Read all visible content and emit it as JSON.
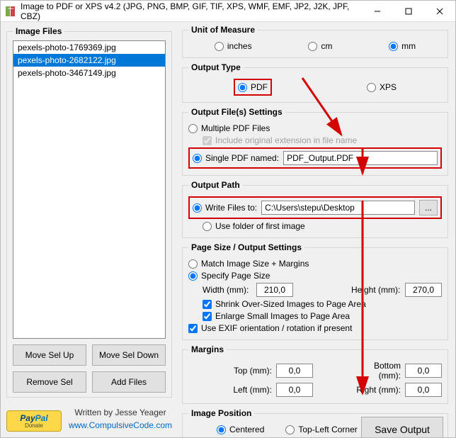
{
  "title": "Image to PDF or XPS  v4.2    (JPG, PNG, BMP, GIF, TIF, XPS, WMF, EMF, JP2, J2K, JPF, CBZ)",
  "left": {
    "legend": "Image Files",
    "files": {
      "f0": "pexels-photo-1769369.jpg",
      "f1": "pexels-photo-2682122.jpg",
      "f2": "pexels-photo-3467149.jpg"
    },
    "moveUp": "Move Sel Up",
    "moveDown": "Move Sel Down",
    "removeSel": "Remove Sel",
    "addFiles": "Add Files",
    "writtenBy": "Written by Jesse Yeager",
    "site": "www.CompulsiveCode.com"
  },
  "unit": {
    "legend": "Unit of Measure",
    "inches": "inches",
    "cm": "cm",
    "mm": "mm"
  },
  "outType": {
    "legend": "Output Type",
    "pdf": "PDF",
    "xps": "XPS"
  },
  "outFile": {
    "legend": "Output File(s) Settings",
    "multiple": "Multiple PDF Files",
    "includeExt": "Include original extension in file name",
    "singleNamed": "Single PDF named:",
    "singleValue": "PDF_Output.PDF"
  },
  "outPath": {
    "legend": "Output Path",
    "writeTo": "Write Files to:",
    "pathValue": "C:\\Users\\stepu\\Desktop",
    "browse": "...",
    "useFolder": "Use folder of first image"
  },
  "pageSize": {
    "legend": "Page Size / Output Settings",
    "match": "Match Image Size + Margins",
    "specify": "Specify Page Size",
    "widthLbl": "Width (mm):",
    "widthVal": "210,0",
    "heightLbl": "Height (mm):",
    "heightVal": "270,0",
    "shrink": "Shrink Over-Sized Images to Page Area",
    "enlarge": "Enlarge Small Images to Page Area",
    "useExif": "Use EXIF orientation / rotation if present"
  },
  "margins": {
    "legend": "Margins",
    "topLbl": "Top (mm):",
    "topVal": "0,0",
    "bottomLbl": "Bottom (mm):",
    "bottomVal": "0,0",
    "leftLbl": "Left (mm):",
    "leftVal": "0,0",
    "rightLbl": "Right (mm):",
    "rightVal": "0,0"
  },
  "imgPos": {
    "legend": "Image Position",
    "centered": "Centered",
    "topLeft": "Top-Left Corner"
  },
  "save": "Save Output"
}
